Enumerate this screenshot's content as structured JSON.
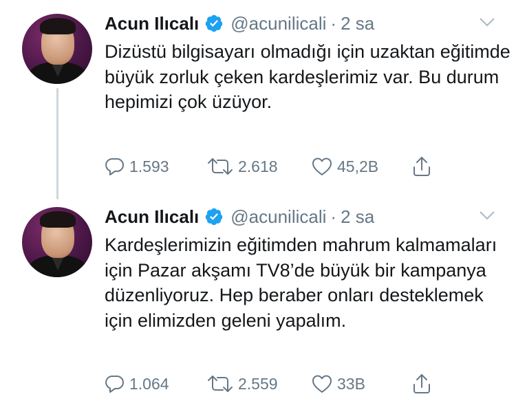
{
  "tweets": [
    {
      "name": "Acun Ilıcalı",
      "handle": "@acunilicali",
      "separator": "·",
      "time": "2 sa",
      "text": "Dizüstü bilgisayarı olmadığı için uzaktan eğitimde büyük zorluk çeken kardeşlerimiz var. Bu durum hepimizi çok üzüyor.",
      "replies": "1.593",
      "retweets": "2.618",
      "likes": "45,2B"
    },
    {
      "name": "Acun Ilıcalı",
      "handle": "@acunilicali",
      "separator": "·",
      "time": "2 sa",
      "text": "Kardeşlerimizin eğitimden mahrum kalmamaları için Pazar akşamı TV8’de büyük bir kampanya düzenliyoruz. Hep beraber onları desteklemek için elimizden geleni yapalım.",
      "replies": "1.064",
      "retweets": "2.559",
      "likes": "33B"
    }
  ],
  "colors": {
    "text": "#14171a",
    "secondary": "#657786",
    "verified": "#1da1f2",
    "thread_line": "#ccd6dd"
  },
  "icons": [
    "verified-badge-icon",
    "chevron-down-icon",
    "reply-icon",
    "retweet-icon",
    "like-icon",
    "share-icon"
  ]
}
